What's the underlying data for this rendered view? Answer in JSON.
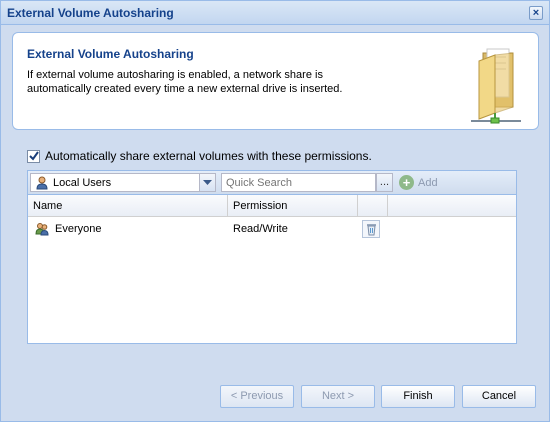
{
  "window": {
    "title": "External Volume Autosharing",
    "close_symbol": "×"
  },
  "header": {
    "title": "External Volume Autosharing",
    "description": "If external volume autosharing is enabled, a network share is automatically created every time a new external drive is inserted.",
    "icon": "folder-share-icon"
  },
  "options": {
    "auto_share_checked": true,
    "auto_share_label": "Automatically share external volumes with these permissions."
  },
  "toolbar": {
    "user_scope_selected": "Local Users",
    "search_placeholder": "Quick Search",
    "search_trigger": "...",
    "add_label": "Add"
  },
  "grid": {
    "columns": [
      "Name",
      "Permission"
    ],
    "rows": [
      {
        "name": "Everyone",
        "permission": "Read/Write"
      }
    ]
  },
  "footer": {
    "previous_label": "< Previous",
    "next_label": "Next >",
    "finish_label": "Finish",
    "cancel_label": "Cancel"
  },
  "colors": {
    "accent": "#15428b",
    "border": "#99bbe8",
    "background": "#cfdcef"
  }
}
